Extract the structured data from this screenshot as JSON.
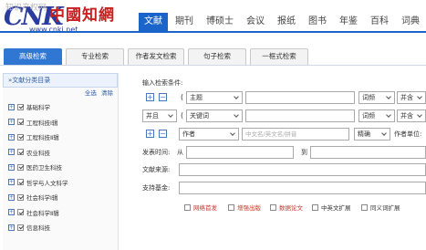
{
  "header": {
    "logo_main": "CNK",
    "logo_cn": "中國知網",
    "logo_url": "www.cnki.net",
    "logo_watermark": "知识产权网"
  },
  "nav": {
    "tabs": [
      {
        "label": "文献",
        "active": true
      },
      {
        "label": "期刊",
        "active": false
      },
      {
        "label": "博硕士",
        "active": false
      },
      {
        "label": "会议",
        "active": false
      },
      {
        "label": "报纸",
        "active": false
      },
      {
        "label": "图书",
        "active": false
      },
      {
        "label": "年鉴",
        "active": false
      },
      {
        "label": "百科",
        "active": false
      },
      {
        "label": "词典",
        "active": false
      }
    ]
  },
  "search_tabs": [
    {
      "label": "高级检索",
      "active": true
    },
    {
      "label": "专业检索",
      "active": false
    },
    {
      "label": "作者发文检索",
      "active": false
    },
    {
      "label": "句子检索",
      "active": false
    },
    {
      "label": "一框式检索",
      "active": false
    }
  ],
  "sidebar": {
    "title": "»文献分类目录",
    "select_all": "全选",
    "clear": "清除",
    "items": [
      {
        "label": "基础科学",
        "checked": true
      },
      {
        "label": "工程科技Ⅰ辑",
        "checked": true
      },
      {
        "label": "工程科技Ⅱ辑",
        "checked": true
      },
      {
        "label": "农业科技",
        "checked": true
      },
      {
        "label": "医药卫生科技",
        "checked": true
      },
      {
        "label": "哲学与人文科学",
        "checked": true
      },
      {
        "label": "社会科学Ⅰ辑",
        "checked": true
      },
      {
        "label": "社会科学Ⅱ辑",
        "checked": true
      },
      {
        "label": "信息科技",
        "checked": true
      }
    ]
  },
  "form": {
    "section_title": "输入检索条件:",
    "row1": {
      "paren": "(",
      "field": "主题",
      "match": "词频",
      "logic": "并含"
    },
    "row2": {
      "op": "并且",
      "paren": "(",
      "field": "关键词",
      "match": "词频",
      "logic": "并含"
    },
    "row3": {
      "field": "作者",
      "placeholder": "中文名/英文名/拼音",
      "match": "精确",
      "label_right": "作者单位:"
    },
    "date": {
      "label": "发表时间:",
      "from": "从",
      "to": "到"
    },
    "source_label": "文献来源:",
    "fund_label": "支持基金:",
    "options": [
      {
        "label": "网络首发",
        "checked": false
      },
      {
        "label": "增强出版",
        "checked": false
      },
      {
        "label": "数据论文",
        "checked": false
      },
      {
        "label": "中英文扩展",
        "checked": false
      },
      {
        "label": "同义词扩展",
        "checked": false
      }
    ]
  },
  "colors": {
    "accent": "#1b64c9",
    "tab_active": "#2f77d3",
    "logo_blue": "#2a3c9e",
    "logo_red": "#c82020",
    "option_red": "#c0392b"
  }
}
